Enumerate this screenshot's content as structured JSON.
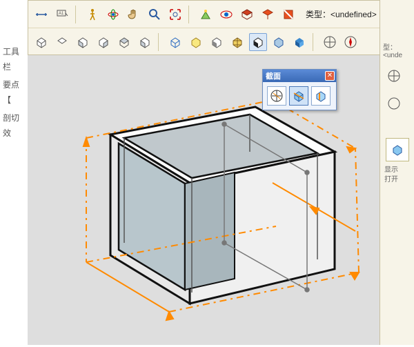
{
  "sidebar": {
    "labels": [
      "工具栏",
      "要点【",
      "剖切效"
    ]
  },
  "toolbar": {
    "type_field": "类型：<undefined>",
    "row1_icons": [
      "dimension",
      "text-label",
      "walk",
      "orbit",
      "pan",
      "zoom",
      "zoom-extents",
      "position-camera",
      "look-around",
      "section-plane",
      "section-display",
      "section-cut"
    ],
    "row2_icons": [
      "view-iso",
      "view-top",
      "view-front",
      "view-right",
      "view-back",
      "view-left",
      "shade-wire",
      "shade-hidden",
      "shade-shaded",
      "shade-texture",
      "shade-mono",
      "shade-xray",
      "shade-color",
      "axes",
      "circle"
    ]
  },
  "float_panel": {
    "title": "截面",
    "buttons": [
      "section-plane-tool",
      "section-display-toggle",
      "section-cut-toggle"
    ],
    "selected_index": 1
  },
  "right_strip": {
    "type_echo": "型：<unde",
    "icon_names": [
      "axes-icon",
      "compass-icon"
    ],
    "text_lines": [
      "显示",
      "打开"
    ]
  },
  "viewport": {
    "model_description": "rectangular hollow box with section plane",
    "section_color": "#ff8a00",
    "face_color": "#b8c6cc"
  }
}
